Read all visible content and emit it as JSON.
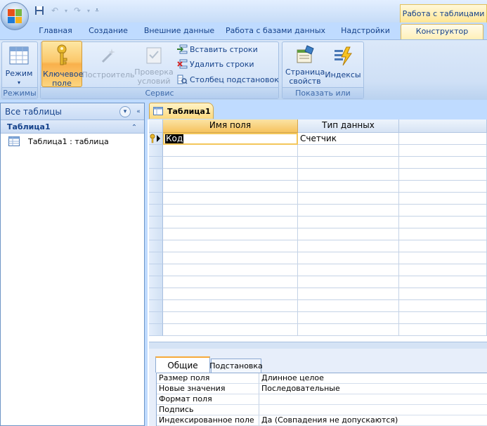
{
  "titlebar": {
    "context_tab": "Работа с таблицами"
  },
  "tabs": [
    {
      "label": "Главная"
    },
    {
      "label": "Создание"
    },
    {
      "label": "Внешние данные"
    },
    {
      "label": "Работа с базами данных"
    },
    {
      "label": "Надстройки"
    },
    {
      "label": "Конструктор"
    }
  ],
  "ribbon": {
    "groups": {
      "views": "Режимы",
      "tools": "Сервис",
      "show_hide": "Показать или скрыть"
    },
    "buttons": {
      "view": "Режим",
      "primary_key": "Ключевое поле",
      "builder": "Построитель",
      "test_rules": "Проверка условий",
      "insert_rows": "Вставить строки",
      "delete_rows": "Удалить строки",
      "lookup_column": "Столбец подстановок",
      "property_sheet": "Страница свойств",
      "indexes": "Индексы"
    }
  },
  "nav": {
    "header": "Все таблицы",
    "group": "Таблица1",
    "item": "Таблица1 : таблица"
  },
  "document": {
    "tab": "Таблица1",
    "columns": [
      "Имя поля",
      "Тип данных"
    ],
    "rows": [
      {
        "field": "Код",
        "type": "Счетчик"
      }
    ]
  },
  "properties": {
    "tabs": [
      "Общие",
      "Подстановка"
    ],
    "rows": [
      {
        "name": "Размер поля",
        "value": "Длинное целое"
      },
      {
        "name": "Новые значения",
        "value": "Последовательные"
      },
      {
        "name": "Формат поля",
        "value": ""
      },
      {
        "name": "Подпись",
        "value": ""
      },
      {
        "name": "Индексированное поле",
        "value": "Да (Совпадения не допускаются)"
      }
    ]
  },
  "colors": {
    "accent": "#fbc769",
    "ribbon": "#dbe8f9",
    "text": "#15428b"
  }
}
